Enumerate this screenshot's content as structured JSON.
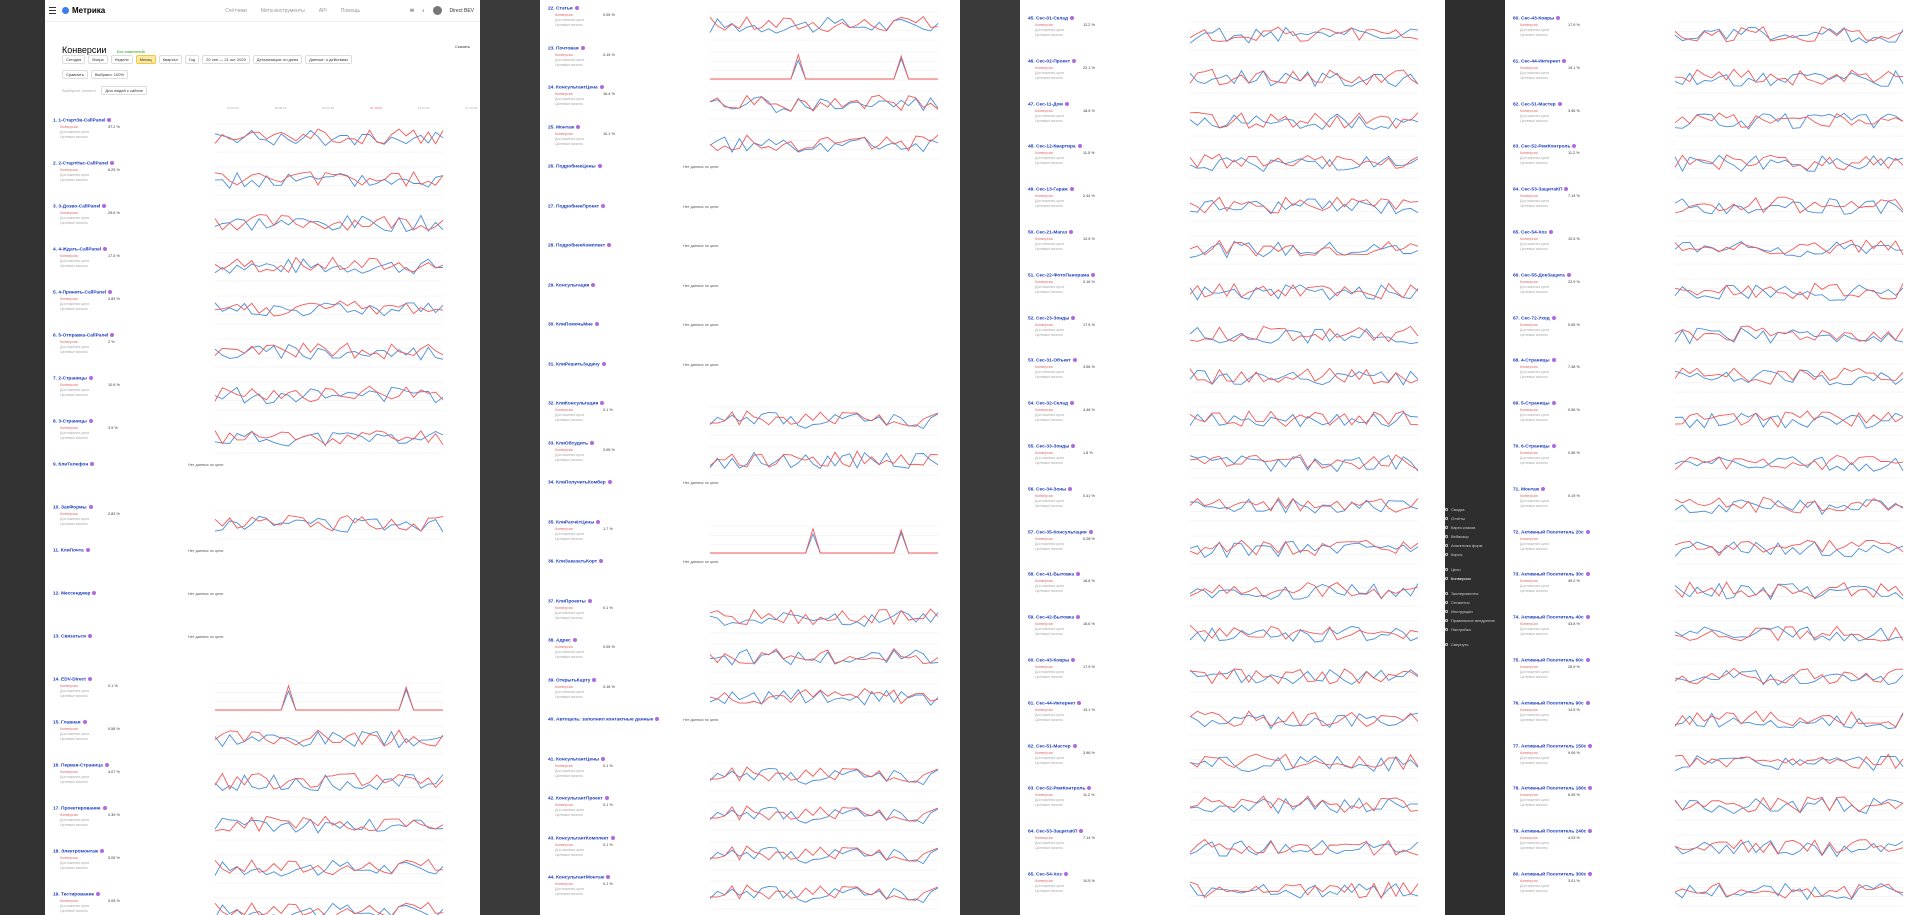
{
  "app": {
    "logo": "Метрика",
    "nav": [
      "Счётчики",
      "Мета-инструменты",
      "API",
      "Помощь"
    ],
    "user": "Direct BEV"
  },
  "page": {
    "title": "Конверсии",
    "status": "Без изменений",
    "share": "Скачать",
    "periods": [
      "Сегодня",
      "Вчера",
      "Неделя",
      "Месяц",
      "Квартал",
      "Год"
    ],
    "selected_period": "Месяц",
    "date_range": "20 сен — 21 окт 2020",
    "detail": "Детализация: по дням",
    "data": "Данные: о действиях",
    "filter1": "Сравнить",
    "filter2": "Выбрано: 100%",
    "segment": "Выберите сегмент",
    "segment_chip": "Для людей с сайтов",
    "axis_dates": [
      "19.09.20",
      "26.09.20",
      "03.10.20",
      "07.10.20",
      "14.10.20",
      "21.10.20"
    ]
  },
  "labels": {
    "conversion": "Конверсия",
    "reached": "Достижения цели",
    "visits": "Целевые визиты",
    "nodata": "Нет данных по цели"
  },
  "colors": {
    "red": "#f05a5a",
    "blue": "#4a8fd8"
  },
  "sidemenu": [
    "Сводка",
    "Отчёты",
    "Карта кликов",
    "Вебвизор",
    "Аналитика форм",
    "Карты",
    "Цели",
    "Конверсии",
    "Эксперименты",
    "Сегменты",
    "Инструкции",
    "Правильное внедрение",
    "Настройка",
    "Свернуть"
  ],
  "goals": [
    {
      "n": "1.",
      "name": "1-СтартЗв-CallPanel",
      "v": "37.2 %",
      "s": 1
    },
    {
      "n": "2.",
      "name": "2-СтартНас-CallPanel",
      "v": "6.25 %",
      "s": 2
    },
    {
      "n": "3.",
      "name": "3-Дозво-CallPanel",
      "v": "29.6 %",
      "s": 3
    },
    {
      "n": "4.",
      "name": "4-Ждать-CallPanel",
      "v": "17.5 %",
      "s": 4
    },
    {
      "n": "5.",
      "name": "4-Принять-CallPanel",
      "v": "2.83 %",
      "s": 5
    },
    {
      "n": "6.",
      "name": "5-Отправка-CallPanel",
      "v": "2 %",
      "s": 6
    },
    {
      "n": "7.",
      "name": "2-Страницы",
      "v": "10.6 %",
      "s": 7
    },
    {
      "n": "8.",
      "name": "3-Страницы",
      "v": "3.9 %",
      "s": 8
    },
    {
      "n": "9.",
      "name": "КлиТелефон",
      "v": "",
      "s": 0
    },
    {
      "n": "10.",
      "name": "ЗакФормы",
      "v": "2.83 %",
      "s": 9
    },
    {
      "n": "11.",
      "name": "КлиПочта",
      "v": "",
      "s": 0
    },
    {
      "n": "12.",
      "name": "Мессенджер",
      "v": "",
      "s": 0
    },
    {
      "n": "13.",
      "name": "Связаться",
      "v": "",
      "s": 0
    },
    {
      "n": "14.",
      "name": "EDV-Direct",
      "v": "0.1 %",
      "s": 10
    },
    {
      "n": "15.",
      "name": "Главная",
      "v": "0.58 %",
      "s": 11
    },
    {
      "n": "16.",
      "name": "Первая-Страница",
      "v": "4.07 %",
      "s": 12
    },
    {
      "n": "17.",
      "name": "Проектирование",
      "v": "0.39 %",
      "s": 13
    },
    {
      "n": "18.",
      "name": "Электромонтаж",
      "v": "0.05 %",
      "s": 14
    },
    {
      "n": "19.",
      "name": "Тестирование",
      "v": "0.05 %",
      "s": 14
    },
    {
      "n": "20.",
      "name": "Обслуживание",
      "v": "",
      "s": 0
    },
    {
      "n": "21.",
      "name": "Компания",
      "v": "0.05 %",
      "s": 14
    },
    {
      "n": "22.",
      "name": "Статьи",
      "v": "0.05 %",
      "s": 14
    },
    {
      "n": "23.",
      "name": "Почтовая",
      "v": "0.15 %",
      "s": 15
    },
    {
      "n": "24.",
      "name": "КонсультантЦена",
      "v": "16.4 %",
      "s": 16
    },
    {
      "n": "25.",
      "name": "Монтаж",
      "v": "10.1 %",
      "s": 17
    },
    {
      "n": "26.",
      "name": "ПодробнееЦены",
      "v": "",
      "s": 0
    },
    {
      "n": "27.",
      "name": "ПодробнееПроект",
      "v": "",
      "s": 0
    },
    {
      "n": "28.",
      "name": "ПодробнееКомплект",
      "v": "",
      "s": 0
    },
    {
      "n": "29.",
      "name": "Консультация",
      "v": "",
      "s": 0
    },
    {
      "n": "30.",
      "name": "КлиПомочьМне",
      "v": "",
      "s": 0
    },
    {
      "n": "31.",
      "name": "КлиРешитьЗадачу",
      "v": "",
      "s": 0
    },
    {
      "n": "32.",
      "name": "КлиКонсультация",
      "v": "0.1 %",
      "s": 18
    },
    {
      "n": "33.",
      "name": "КлиОбсудить",
      "v": "0.05 %",
      "s": 19
    },
    {
      "n": "34.",
      "name": "КлиПолучитьКомбер",
      "v": "",
      "s": 0
    },
    {
      "n": "35.",
      "name": "КлиРасчётЦены",
      "v": "1.7 %",
      "s": 20
    },
    {
      "n": "36.",
      "name": "КлиЗаказатьКорт",
      "v": "",
      "s": 0
    },
    {
      "n": "37.",
      "name": "КлиПроекты",
      "v": "0.1 %",
      "s": 21
    },
    {
      "n": "38.",
      "name": "Адрес",
      "v": "0.05 %",
      "s": 22
    },
    {
      "n": "39.",
      "name": "ОткрытьКарту",
      "v": "0.16 %",
      "s": 23
    },
    {
      "n": "40.",
      "name": "Автоцель: заполнил контактные данные",
      "v": "",
      "s": 0
    },
    {
      "n": "41.",
      "name": "КонсультантЦены",
      "v": "0.1 %",
      "s": 18
    },
    {
      "n": "42.",
      "name": "КонсультантПроект",
      "v": "0.1 %",
      "s": 18
    },
    {
      "n": "43.",
      "name": "КонсультантКомплект",
      "v": "0.1 %",
      "s": 18
    },
    {
      "n": "44.",
      "name": "КонсультантМонтаж",
      "v": "0.1 %",
      "s": 18
    },
    {
      "n": "45.",
      "name": "Сеc-01-Склад",
      "v": "12.2 %",
      "s": 24
    },
    {
      "n": "46.",
      "name": "Сеc-02-Проект",
      "v": "22.1 %",
      "s": 25
    },
    {
      "n": "47.",
      "name": "Сеc-11-Дом",
      "v": "18.5 %",
      "s": 26
    },
    {
      "n": "48.",
      "name": "Сеc-12-Квартира",
      "v": "11.5 %",
      "s": 27
    },
    {
      "n": "49.",
      "name": "Сеc-13-Гараж",
      "v": "2.44 %",
      "s": 28
    },
    {
      "n": "50.",
      "name": "Сеc-21-Магаз",
      "v": "12.5 %",
      "s": 29
    },
    {
      "n": "51.",
      "name": "Сеc-22-ФотоПанорама",
      "v": "0.16 %",
      "s": 30
    },
    {
      "n": "52.",
      "name": "Сеc-23-Зонды",
      "v": "17.5 %",
      "s": 31
    },
    {
      "n": "53.",
      "name": "Сеc-31-Объект",
      "v": "3.56 %",
      "s": 32
    },
    {
      "n": "54.",
      "name": "Сеc-32-Склад",
      "v": "4.46 %",
      "s": 33
    },
    {
      "n": "55.",
      "name": "Сеc-33-Зонды",
      "v": "1.8 %",
      "s": 34
    },
    {
      "n": "56.",
      "name": "Сеc-34-Зоны",
      "v": "0.41 %",
      "s": 35
    },
    {
      "n": "57.",
      "name": "Сеc-35-Консультация",
      "v": "0.28 %",
      "s": 36
    },
    {
      "n": "58.",
      "name": "Сеc-41-Бытовка",
      "v": "16.6 %",
      "s": 37
    },
    {
      "n": "59.",
      "name": "Сеc-42-Бытовка",
      "v": "16.6 %",
      "s": 38
    },
    {
      "n": "60.",
      "name": "Сеc-43-Ковры",
      "v": "17.9 %",
      "s": 39
    },
    {
      "n": "61.",
      "name": "Сеc-44-Интернет",
      "v": "19.1 %",
      "s": 40
    },
    {
      "n": "62.",
      "name": "Сеc-51-Мастер",
      "v": "3.96 %",
      "s": 41
    },
    {
      "n": "63.",
      "name": "Сеc-52-РемКонтроль",
      "v": "11.2 %",
      "s": 42
    },
    {
      "n": "64.",
      "name": "Сеc-53-ЗащитаКП",
      "v": "7.14 %",
      "s": 43
    },
    {
      "n": "65.",
      "name": "Сеc-54-Хоз",
      "v": "10.5 %",
      "s": 44
    },
    {
      "n": "66.",
      "name": "Сеc-55-ДокЗащита",
      "v": "",
      "s": 45
    },
    {
      "n": "60.",
      "name": "Сеc-43-Ковры",
      "v": "17.9 %",
      "s": 46
    },
    {
      "n": "61.",
      "name": "Сеc-44-Интернет",
      "v": "19.1 %",
      "s": 47
    },
    {
      "n": "62.",
      "name": "Сеc-51-Мастер",
      "v": "3.96 %",
      "s": 48
    },
    {
      "n": "63.",
      "name": "Сеc-52-РемКонтроль",
      "v": "11.2 %",
      "s": 49
    },
    {
      "n": "64.",
      "name": "Сеc-53-ЗащитаКП",
      "v": "7.14 %",
      "s": 50
    },
    {
      "n": "65.",
      "name": "Сеc-54-Хоз",
      "v": "10.5 %",
      "s": 51
    },
    {
      "n": "66.",
      "name": "Сеc-55-ДокЗащита",
      "v": "22.9 %",
      "s": 52
    },
    {
      "n": "67.",
      "name": "Сеc-72-Уход",
      "v": "0.65 %",
      "s": 53
    },
    {
      "n": "68.",
      "name": "4-Страницы",
      "v": "7.38 %",
      "s": 54
    },
    {
      "n": "69.",
      "name": "5-Страницы",
      "v": "0.56 %",
      "s": 55
    },
    {
      "n": "70.",
      "name": "6-Страницы",
      "v": "0.56 %",
      "s": 56
    },
    {
      "n": "71.",
      "name": "Монтаж",
      "v": "0.19 %",
      "s": 57
    },
    {
      "n": "72.",
      "name": "Активный Посетитель 20с",
      "v": "",
      "s": 58
    },
    {
      "n": "73.",
      "name": "Активный Посетитель 30с",
      "v": "49.2 %",
      "s": 59
    },
    {
      "n": "74.",
      "name": "Активный Посетитель 40с",
      "v": "43.8 %",
      "s": 60
    },
    {
      "n": "75.",
      "name": "Активный Посетитель 60с",
      "v": "26.9 %",
      "s": 61
    },
    {
      "n": "76.",
      "name": "Активный Посетитель 90с",
      "v": "14.5 %",
      "s": 62
    },
    {
      "n": "77.",
      "name": "Активный Посетитель 150с",
      "v": "9.06 %",
      "s": 63
    },
    {
      "n": "78.",
      "name": "Активный Посетитель 180с",
      "v": "6.05 %",
      "s": 64
    },
    {
      "n": "79.",
      "name": "Активный Посетитель 240с",
      "v": "4.03 %",
      "s": 65
    },
    {
      "n": "80.",
      "name": "Активный Посетитель 300с",
      "v": "3.01 %",
      "s": 66
    },
    {
      "n": "81.",
      "name": "Активный Посетитель 360с",
      "v": "2.48 %",
      "s": 67
    },
    {
      "n": "82.",
      "name": "Состояние цели «Счётчик Кошка»",
      "v": "",
      "s": 0
    }
  ]
}
